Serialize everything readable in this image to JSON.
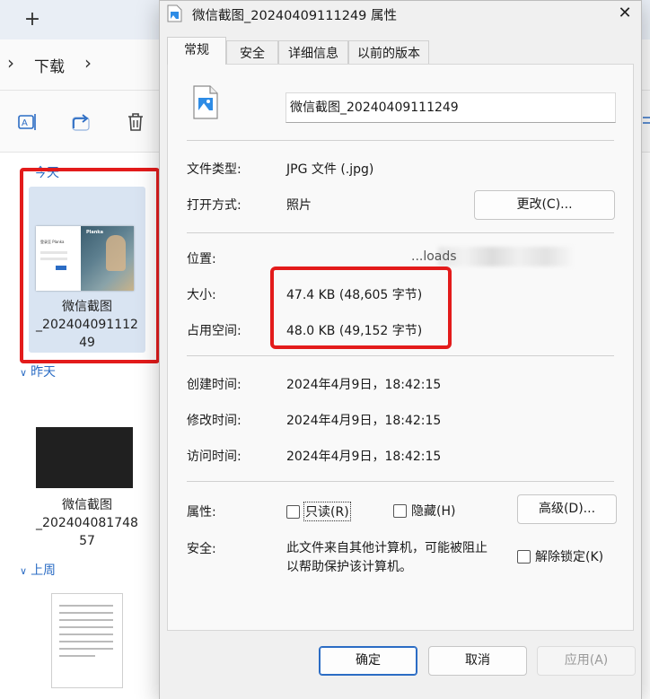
{
  "explorer": {
    "new_tab_glyph": "+",
    "breadcrumb": "下载",
    "groups": {
      "today": "今天",
      "yesterday": "昨天",
      "last_week": "上周"
    },
    "files": [
      {
        "name": "微信截图_20240409111249",
        "line1": "微信截图",
        "line2": "_202404091112",
        "line3": "49"
      },
      {
        "name": "微信截图_20240408174857",
        "line1": "微信截图",
        "line2": "_202404081748",
        "line3": "57"
      }
    ],
    "thumb_text": {
      "brand": "Planka",
      "login": "登录至 Planka"
    }
  },
  "dialog": {
    "title": "微信截图_20240409111249 属性",
    "tabs": [
      "常规",
      "安全",
      "详细信息",
      "以前的版本"
    ],
    "file_name": "微信截图_20240409111249",
    "file_type_label": "文件类型:",
    "file_type_value": "JPG 文件 (.jpg)",
    "open_with_label": "打开方式:",
    "open_with_value": "照片",
    "change_button": "更改(C)...",
    "location_label": "位置:",
    "location_value_visible": "...loads",
    "size_label": "大小:",
    "size_value": "47.4 KB (48,605 字节)",
    "size_on_disk_label": "占用空间:",
    "size_on_disk_value": "48.0 KB (49,152 字节)",
    "created_label": "创建时间:",
    "created_value": "2024年4月9日，18:42:15",
    "modified_label": "修改时间:",
    "modified_value": "2024年4月9日，18:42:15",
    "accessed_label": "访问时间:",
    "accessed_value": "2024年4月9日，18:42:15",
    "attributes_label": "属性:",
    "readonly_label": "只读(R)",
    "hidden_label": "隐藏(H)",
    "advanced_button": "高级(D)...",
    "security_label": "安全:",
    "security_line1": "此文件来自其他计算机，可能被阻止",
    "security_line2": "以帮助保护该计算机。",
    "unblock_label": "解除锁定(K)",
    "ok_button": "确定",
    "cancel_button": "取消",
    "apply_button": "应用(A)",
    "close_glyph": "✕"
  },
  "colors": {
    "highlight_red": "#e31b1b",
    "accent_blue": "#2b6cc4"
  }
}
